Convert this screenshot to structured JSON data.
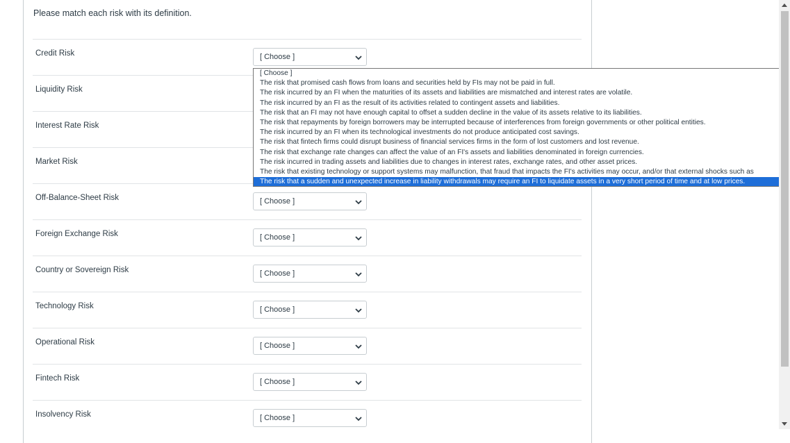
{
  "prompt": "Please match each risk with its definition.",
  "risks": [
    {
      "label": "Credit Risk",
      "selected": "[ Choose ]"
    },
    {
      "label": "Liquidity Risk",
      "selected": "[ Choose ]"
    },
    {
      "label": "Interest Rate Risk",
      "selected": "[ Choose ]"
    },
    {
      "label": "Market Risk",
      "selected": "[ Choose ]"
    },
    {
      "label": "Off-Balance-Sheet Risk",
      "selected": "[ Choose ]"
    },
    {
      "label": "Foreign Exchange Risk",
      "selected": "[ Choose ]"
    },
    {
      "label": "Country or Sovereign Risk",
      "selected": "[ Choose ]"
    },
    {
      "label": "Technology Risk",
      "selected": "[ Choose ]"
    },
    {
      "label": "Operational Risk",
      "selected": "[ Choose ]"
    },
    {
      "label": "Fintech Risk",
      "selected": "[ Choose ]"
    },
    {
      "label": "Insolvency Risk",
      "selected": "[ Choose ]"
    }
  ],
  "dropdown": {
    "highlighted_index": 11,
    "options": [
      "[ Choose ]",
      "The risk that promised cash flows from loans and securities held by FIs may not be paid in full.",
      "The risk incurred by an FI when the maturities of its assets and liabilities are mismatched and interest rates are volatile.",
      "The risk incurred by an FI as the result of its activities related to contingent assets and liabilities.",
      "The risk that an FI may not have enough capital to offset a sudden decline in the value of its assets relative to its liabilities.",
      "The risk that repayments by foreign borrowers may be interrupted because of interferences from foreign governments or other political entities.",
      "The risk incurred by an FI when its technological investments do not produce anticipated cost savings.",
      "The risk that fintech firms could disrupt business of financial services firms in the form of lost customers and lost revenue.",
      "The risk that exchange rate changes can affect the value of an FI's assets and liabilities denominated in foreign currencies.",
      "The risk incurred in trading assets and liabilities due to changes in interest rates, exchange rates, and other asset prices.",
      "The risk that existing technology or support systems may malfunction, that fraud that impacts the FI's activities may occur, and/or that external shocks such as",
      "The risk that a sudden and unexpected increase in liability withdrawals may require an FI to liquidate assets in a very short period of time and at low prices."
    ]
  },
  "icons": {
    "select_arrow": "chevron-down-icon",
    "scroll_up": "arrow-up-icon",
    "scroll_down": "arrow-down-icon"
  },
  "colors": {
    "highlight": "#1e6ed8",
    "text": "#2d3b45",
    "border": "#c7cdd1"
  }
}
